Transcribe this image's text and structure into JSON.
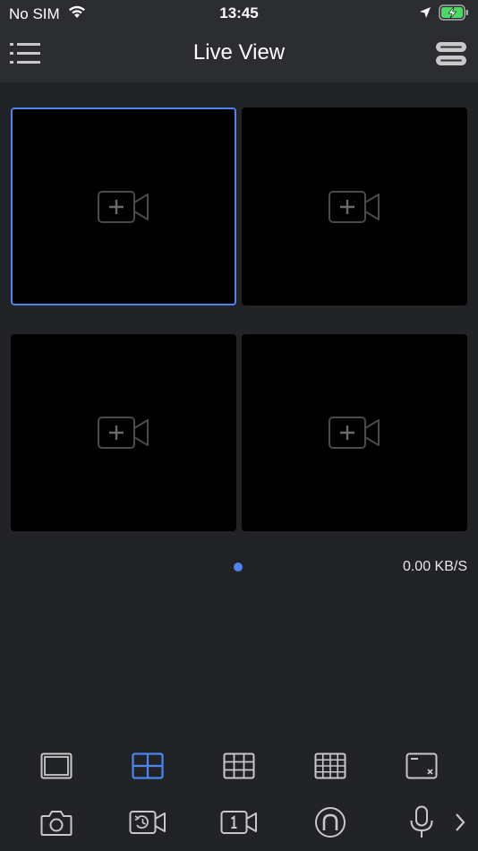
{
  "status_bar": {
    "carrier": "No SIM",
    "time": "13:45"
  },
  "header": {
    "title": "Live View"
  },
  "grid": {
    "tiles": [
      {
        "selected": true,
        "icon": "add-camera-icon"
      },
      {
        "selected": false,
        "icon": "add-camera-icon"
      },
      {
        "selected": false,
        "icon": "add-camera-icon"
      },
      {
        "selected": false,
        "icon": "add-camera-icon"
      }
    ]
  },
  "page_indicator": {
    "current": 1,
    "total": 1
  },
  "bitrate": "0.00 KB/S",
  "colors": {
    "accent": "#4d84ee",
    "background": "#222327",
    "bar": "#2c2d31",
    "icon": "#c8c8c8"
  },
  "layout_toolbar": {
    "items": [
      {
        "icon": "single-view-icon",
        "active": false
      },
      {
        "icon": "four-view-icon",
        "active": true
      },
      {
        "icon": "nine-view-icon",
        "active": false
      },
      {
        "icon": "sixteen-view-icon",
        "active": false
      },
      {
        "icon": "close-all-views-icon",
        "active": false
      }
    ]
  },
  "action_toolbar": {
    "items": [
      {
        "icon": "snapshot-icon"
      },
      {
        "icon": "playback-icon"
      },
      {
        "icon": "record-icon"
      },
      {
        "icon": "ptz-icon"
      },
      {
        "icon": "microphone-icon"
      },
      {
        "icon": "chevron-right-icon"
      }
    ]
  }
}
